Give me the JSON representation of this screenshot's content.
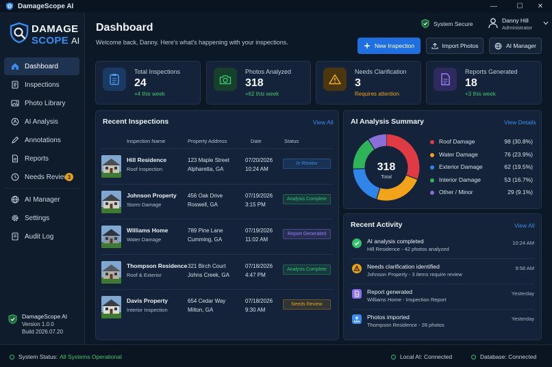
{
  "window": {
    "title": "DamageScope AI",
    "controls": [
      "—",
      "☐",
      "✕"
    ]
  },
  "brand": {
    "line1": "DAMAGE",
    "line2": "SCOPE",
    "suffix": "AI"
  },
  "sidebar": {
    "items": [
      {
        "label": "Dashboard",
        "icon": "home-icon",
        "active": true
      },
      {
        "label": "Inspections",
        "icon": "document-icon"
      },
      {
        "label": "Photo Library",
        "icon": "image-icon"
      },
      {
        "label": "AI Analysis",
        "icon": "ai-icon"
      },
      {
        "label": "Annotations",
        "icon": "pen-icon"
      },
      {
        "label": "Reports",
        "icon": "report-icon"
      },
      {
        "label": "Needs Review",
        "icon": "clock-icon",
        "badge": "3"
      },
      {
        "label": "AI Manager",
        "icon": "globe-icon"
      },
      {
        "label": "Settings",
        "icon": "gear-icon"
      },
      {
        "label": "Audit Log",
        "icon": "log-icon"
      }
    ],
    "footer": {
      "name": "DamageScope AI",
      "version": "Version 1.0.0",
      "build": "Build 2026.07.20"
    }
  },
  "header": {
    "title": "Dashboard",
    "subtitle": "Welcome back, Danny. Here's what's happening with your inspections.",
    "system_status": "System Secure",
    "user_name": "Danny Hill",
    "user_role": "Administrator",
    "buttons": {
      "new_inspection": "New Inspection",
      "import_photos": "Import Photos",
      "ai_manager": "AI Manager"
    }
  },
  "stats": [
    {
      "label": "Total Inspections",
      "value": "24",
      "delta": "+4 this week",
      "color": "#3b8cf0"
    },
    {
      "label": "Photos Analyzed",
      "value": "318",
      "delta": "+62 this week",
      "color": "#33c26a"
    },
    {
      "label": "Needs Clarification",
      "value": "3",
      "delta": "Requires attention",
      "color": "#e7a317"
    },
    {
      "label": "Reports Generated",
      "value": "18",
      "delta": "+3 this week",
      "color": "#8a6ff0"
    }
  ],
  "recent_inspections": {
    "title": "Recent Inspections",
    "view_all": "View All",
    "columns": [
      "Inspection Name",
      "Property Address",
      "Date",
      "Status"
    ],
    "rows": [
      {
        "name": "Hill Residence",
        "type": "Roof Inspection",
        "addr1": "123 Maple Street",
        "addr2": "Alpharetta, GA",
        "date": "07/20/2026",
        "time": "10:24 AM",
        "status": "In Review",
        "status_color": "#3b8cf0"
      },
      {
        "name": "Johnson Property",
        "type": "Storm Damage",
        "addr1": "456 Oak Drive",
        "addr2": "Roswell, GA",
        "date": "07/19/2026",
        "time": "3:15 PM",
        "status": "Analysis Complete",
        "status_color": "#33c26a"
      },
      {
        "name": "Williams Home",
        "type": "Water Damage",
        "addr1": "789 Pine Lane",
        "addr2": "Cumming, GA",
        "date": "07/19/2026",
        "time": "11:02 AM",
        "status": "Report Generated",
        "status_color": "#9b7df5"
      },
      {
        "name": "Thompson Residence",
        "type": "Roof & Exterior",
        "addr1": "321 Birch Court",
        "addr2": "Johns Creek, GA",
        "date": "07/18/2026",
        "time": "4:47 PM",
        "status": "Analysis Complete",
        "status_color": "#33c26a"
      },
      {
        "name": "Davis Property",
        "type": "Interior Inspection",
        "addr1": "654 Cedar Way",
        "addr2": "Milton, GA",
        "date": "07/18/2026",
        "time": "9:30 AM",
        "status": "Needs Review",
        "status_color": "#e7a317"
      }
    ]
  },
  "ai_summary": {
    "title": "AI Analysis Summary",
    "view_details": "View Details",
    "total_value": "318",
    "total_label": "Total"
  },
  "chart_data": {
    "type": "pie",
    "categories": [
      "Roof Damage",
      "Water Damage",
      "Exterior Damage",
      "Interior Damage",
      "Other / Minor"
    ],
    "values": [
      98,
      76,
      62,
      53,
      29
    ],
    "value_labels": [
      "98 (30.8%)",
      "76 (23.9%)",
      "62 (19.5%)",
      "53 (16.7%)",
      "29 (9.1%)"
    ],
    "colors": [
      "#de3b45",
      "#f2a31c",
      "#2f86e8",
      "#2fb45a",
      "#8a6fd6"
    ],
    "legend": "right"
  },
  "recent_activity": {
    "title": "Recent Activity",
    "view_all": "View All",
    "items": [
      {
        "title": "AI analysis completed",
        "detail": "Hill Residence - 42 photos analyzed",
        "time": "10:24 AM",
        "icon": "check-icon",
        "color": "#33c26a"
      },
      {
        "title": "Needs clarification identified",
        "detail": "Johnson Property - 3 items require review",
        "time": "9:58 AM",
        "icon": "warning-icon",
        "color": "#e7a317"
      },
      {
        "title": "Report generated",
        "detail": "Williams Home - Inspection Report",
        "time": "Yesterday",
        "icon": "report-icon",
        "color": "#8a6ff0"
      },
      {
        "title": "Photos imported",
        "detail": "Thompson Residence - 28 photos",
        "time": "Yesterday",
        "icon": "upload-icon",
        "color": "#3b8cf0"
      }
    ]
  },
  "statusbar": {
    "system_label": "System Status:",
    "system_value": "All Systems Operational",
    "local_ai": "Local AI: Connected",
    "database": "Database: Connected"
  }
}
